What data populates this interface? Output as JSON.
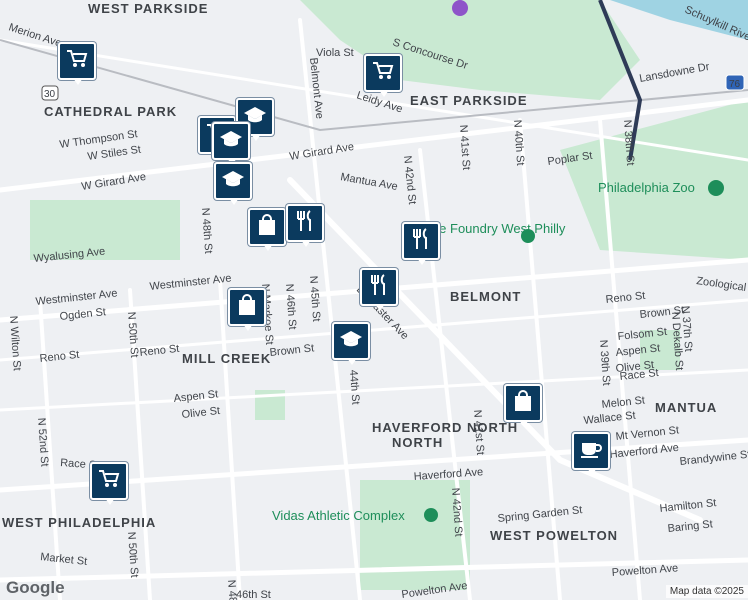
{
  "map": {
    "neighborhoods": [
      "WEST PARKSIDE",
      "CATHEDRAL PARK",
      "EAST PARKSIDE",
      "BELMONT",
      "MILL CREEK",
      "MANTUA",
      "HAVERFORD NORTH",
      "WEST PHILADELPHIA",
      "WEST POWELTON"
    ],
    "streets": [
      "Merion Ave",
      "Viola St",
      "S Concourse Dr",
      "Lansdowne Dr",
      "Leidy Ave",
      "Belmont Ave",
      "W Thompson St",
      "W Stiles St",
      "W Girard Ave",
      "Poplar St",
      "Mantua Ave",
      "N 42nd St",
      "N 41st St",
      "N 40th St",
      "N 38th St",
      "N 48th St",
      "Wyalusing Ave",
      "Westminster Ave",
      "Ogden St",
      "N 50th St",
      "N Markoe St",
      "N 46th St",
      "N 45th St",
      "Reno St",
      "Brown St",
      "Folsom St",
      "Aspen St",
      "Olive St",
      "Melon St",
      "N 39th St",
      "N Dekalb St",
      "N 37th St",
      "44th St",
      "N 41st St",
      "Wallace St",
      "Mt Vernon St",
      "Haverford Ave",
      "Brandywine St",
      "Race St",
      "Hamilton St",
      "Spring Garden St",
      "Baring St",
      "N 52nd St",
      "N Wilton St",
      "Market St",
      "Powelton Ave",
      "N 42nd St",
      "46th St",
      "Lancaster Ave",
      "Zoological Dr",
      "Schuylkill River"
    ],
    "pois": [
      "The Foundry West Philly",
      "Philadelphia Zoo",
      "Vidas Athletic Complex"
    ],
    "highway_shields": [
      "30",
      "76"
    ],
    "brand": "Google",
    "attribution": "Map data ©2025"
  },
  "markers": [
    {
      "icon": "cart-icon"
    },
    {
      "icon": "cart-icon"
    },
    {
      "icon": "cart-icon"
    },
    {
      "icon": "cart-icon"
    },
    {
      "icon": "school-icon"
    },
    {
      "icon": "school-icon"
    },
    {
      "icon": "school-icon"
    },
    {
      "icon": "school-icon"
    },
    {
      "icon": "shopping-bag-icon"
    },
    {
      "icon": "shopping-bag-icon"
    },
    {
      "icon": "shopping-bag-icon"
    },
    {
      "icon": "restaurant-icon"
    },
    {
      "icon": "restaurant-icon"
    },
    {
      "icon": "restaurant-icon"
    },
    {
      "icon": "cafe-icon"
    }
  ],
  "colors": {
    "marker": "#0b3a5e",
    "park": "#c9e9d2",
    "water": "#9fd3e3",
    "road": "#ffffff",
    "background": "#eef0f3",
    "poi": "#1e8e5a"
  }
}
